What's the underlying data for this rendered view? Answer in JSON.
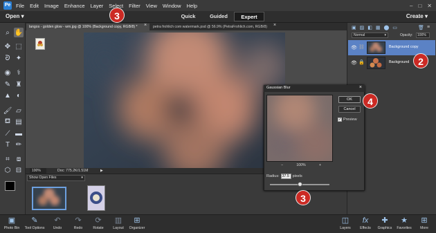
{
  "menubar": {
    "app_icon": "Pe",
    "items": [
      "File",
      "Edit",
      "Image",
      "Enhance",
      "Layer",
      "Select",
      "Filter",
      "View",
      "Window",
      "Help"
    ],
    "window_controls": [
      "–",
      "□",
      "✕"
    ]
  },
  "modebar": {
    "open_label": "Open",
    "modes": [
      "Quick",
      "Guided",
      "Expert"
    ],
    "active_mode": "Expert",
    "create_label": "Create"
  },
  "tabs": [
    {
      "label": "langos - golden glow - wm.jpg @ 100% (Background copy, RGB/8) *",
      "close": "×"
    },
    {
      "label": "petra frohlich com watermark.psd @ 56.9% (PetraFrohlich.com, RGB/8)",
      "close": "×"
    }
  ],
  "status": {
    "zoom": "100%",
    "doc": "Doc: 775.2K/1.51M"
  },
  "photo_bin": {
    "select_label": "Show Open Files"
  },
  "layers_panel": {
    "blend_mode": "Normal",
    "opacity_label": "Opacity:",
    "opacity_value": "100%",
    "layers": [
      {
        "name": "Background copy",
        "selected": true
      },
      {
        "name": "Background",
        "selected": false
      }
    ]
  },
  "dialog": {
    "title": "Gaussian Blur",
    "close": "×",
    "ok_label": "OK",
    "cancel_label": "Cancel",
    "preview_label": "Preview",
    "preview_checked": "✓",
    "zoom_minus": "−",
    "zoom_value": "100%",
    "zoom_plus": "+",
    "radius_label": "Radius:",
    "radius_value": "37.5",
    "radius_unit": "pixels",
    "slider_position": 0.51
  },
  "bottombar": {
    "items": [
      {
        "label": "Photo Bin",
        "icon": "photo-bin-icon"
      },
      {
        "label": "Tool Options",
        "icon": "tool-options-icon"
      },
      {
        "label": "Undo",
        "icon": "undo-icon"
      },
      {
        "label": "Redo",
        "icon": "redo-icon"
      },
      {
        "label": "Rotate",
        "icon": "rotate-icon"
      },
      {
        "label": "Layout",
        "icon": "layout-icon"
      },
      {
        "label": "Organizer",
        "icon": "organizer-icon"
      },
      {
        "label": "Layers",
        "icon": "layers-icon"
      },
      {
        "label": "Effects",
        "icon": "effects-icon"
      },
      {
        "label": "Graphics",
        "icon": "graphics-icon"
      },
      {
        "label": "Favorites",
        "icon": "favorites-icon"
      },
      {
        "label": "More",
        "icon": "more-icon"
      }
    ]
  },
  "annotations": [
    "3",
    "2",
    "4",
    "3"
  ],
  "colors": {
    "accent": "#cc2a24",
    "selected_layer": "#5b82c5",
    "canvas_bg": "#535353"
  }
}
